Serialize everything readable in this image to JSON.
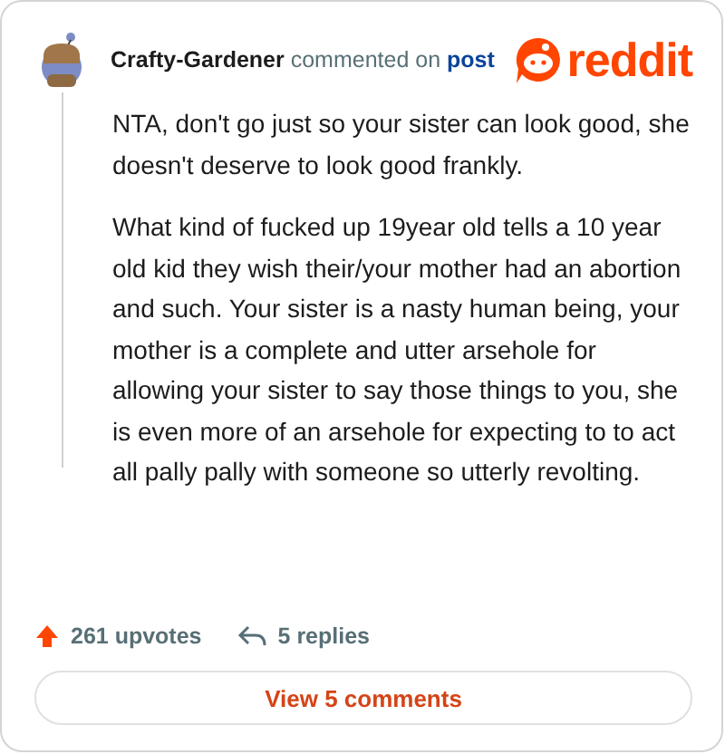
{
  "comment": {
    "author": "Crafty-Gardener",
    "action": "commented on",
    "target": "post",
    "paragraphs": [
      "NTA, don't go just so your sister can look good, she doesn't deserve to look good frankly.",
      "What kind of fucked up 19year old tells a 10 year old kid they wish their/your mother had an abortion and such. Your sister is a nasty human being, your mother is a complete and utter arsehole for allowing your sister to say those things to you, she is even more of an arsehole for expecting to to act all pally pally with someone so utterly revolting."
    ],
    "upvotes": "261 upvotes",
    "replies": "5 replies"
  },
  "logo": {
    "text": "reddit"
  },
  "button": {
    "label": "View 5 comments"
  }
}
